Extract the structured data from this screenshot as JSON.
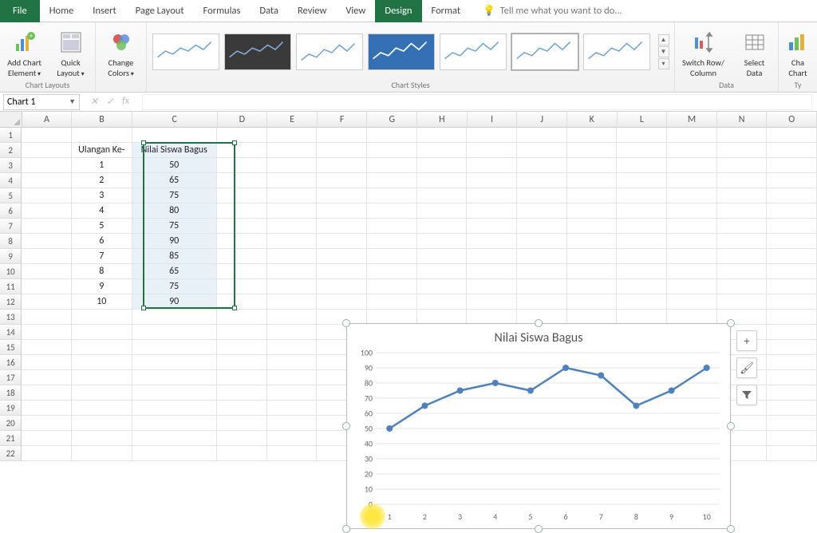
{
  "tabs": {
    "file": "File",
    "home": "Home",
    "insert": "Insert",
    "pagelayout": "Page Layout",
    "formulas": "Formulas",
    "data": "Data",
    "review": "Review",
    "view": "View",
    "design": "Design",
    "format": "Format",
    "tellme": "Tell me what you want to do..."
  },
  "ribbon": {
    "addchart": "Add Chart\nElement",
    "quicklayout": "Quick\nLayout",
    "changecolors": "Change\nColors",
    "chartlayouts": "Chart Layouts",
    "chartstyles": "Chart Styles",
    "switchrowcol": "Switch Row/\nColumn",
    "selectdata": "Select\nData",
    "changechart": "Cha\nChart",
    "datagroup": "Data",
    "typegroup": "Ty"
  },
  "namebox": "Chart 1",
  "columns": [
    "A",
    "B",
    "C",
    "D",
    "E",
    "F",
    "G",
    "H",
    "I",
    "J",
    "K",
    "L",
    "M",
    "N",
    "O"
  ],
  "table": {
    "hdr_b": "Ulangan Ke-",
    "hdr_c": "Nilai Siswa Bagus",
    "rows": [
      {
        "b": "1",
        "c": "50"
      },
      {
        "b": "2",
        "c": "65"
      },
      {
        "b": "3",
        "c": "75"
      },
      {
        "b": "4",
        "c": "80"
      },
      {
        "b": "5",
        "c": "75"
      },
      {
        "b": "6",
        "c": "90"
      },
      {
        "b": "7",
        "c": "85"
      },
      {
        "b": "8",
        "c": "65"
      },
      {
        "b": "9",
        "c": "75"
      },
      {
        "b": "10",
        "c": "90"
      }
    ]
  },
  "chart_btns": {
    "plus": "+",
    "brush": "✎",
    "filter": "▼"
  },
  "chart_data": {
    "type": "line",
    "title": "Nilai Siswa Bagus",
    "categories": [
      "1",
      "2",
      "3",
      "4",
      "5",
      "6",
      "7",
      "8",
      "9",
      "10"
    ],
    "values": [
      50,
      65,
      75,
      80,
      75,
      90,
      85,
      65,
      75,
      90
    ],
    "ylim": [
      0,
      100
    ],
    "yticks": [
      0,
      10,
      20,
      30,
      40,
      50,
      60,
      70,
      80,
      90,
      100
    ],
    "xlabel": "",
    "ylabel": ""
  }
}
